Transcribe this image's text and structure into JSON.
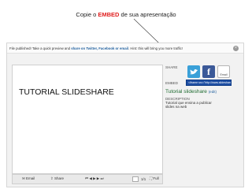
{
  "caption": {
    "before": "Copie o ",
    "highlight": "EMBED",
    "after": " de sua apresentação"
  },
  "banner": {
    "text1": "File published! Take a quick preview and ",
    "share": "share on Twitter, Facebook or email",
    "text2": ". Hint: this will bring you more traffic!",
    "close": "×"
  },
  "slide": {
    "title": "TUTORIAL SLIDESHARE"
  },
  "share_panel": {
    "share_label": "SHARE",
    "embed_label": "EMBED",
    "embed_value": "<iframe src=\"http://www.slideshare",
    "email_button": "Email",
    "facebook_glyph": "f"
  },
  "details": {
    "title": "Tutorial slideshare",
    "edit": "(edit)",
    "description_label": "DESCRIPTION",
    "description_text": "Tutorial que ensina a publicar slides na web"
  },
  "player": {
    "email": "Email",
    "share": "Share",
    "page_total": "1/1",
    "full": "Full"
  },
  "colors": {
    "highlight": "#e02020",
    "embed_field": "#1f4fa3",
    "title_green": "#1d6a2f",
    "facebook": "#3b5998",
    "twitter": "#3aa0d8"
  }
}
